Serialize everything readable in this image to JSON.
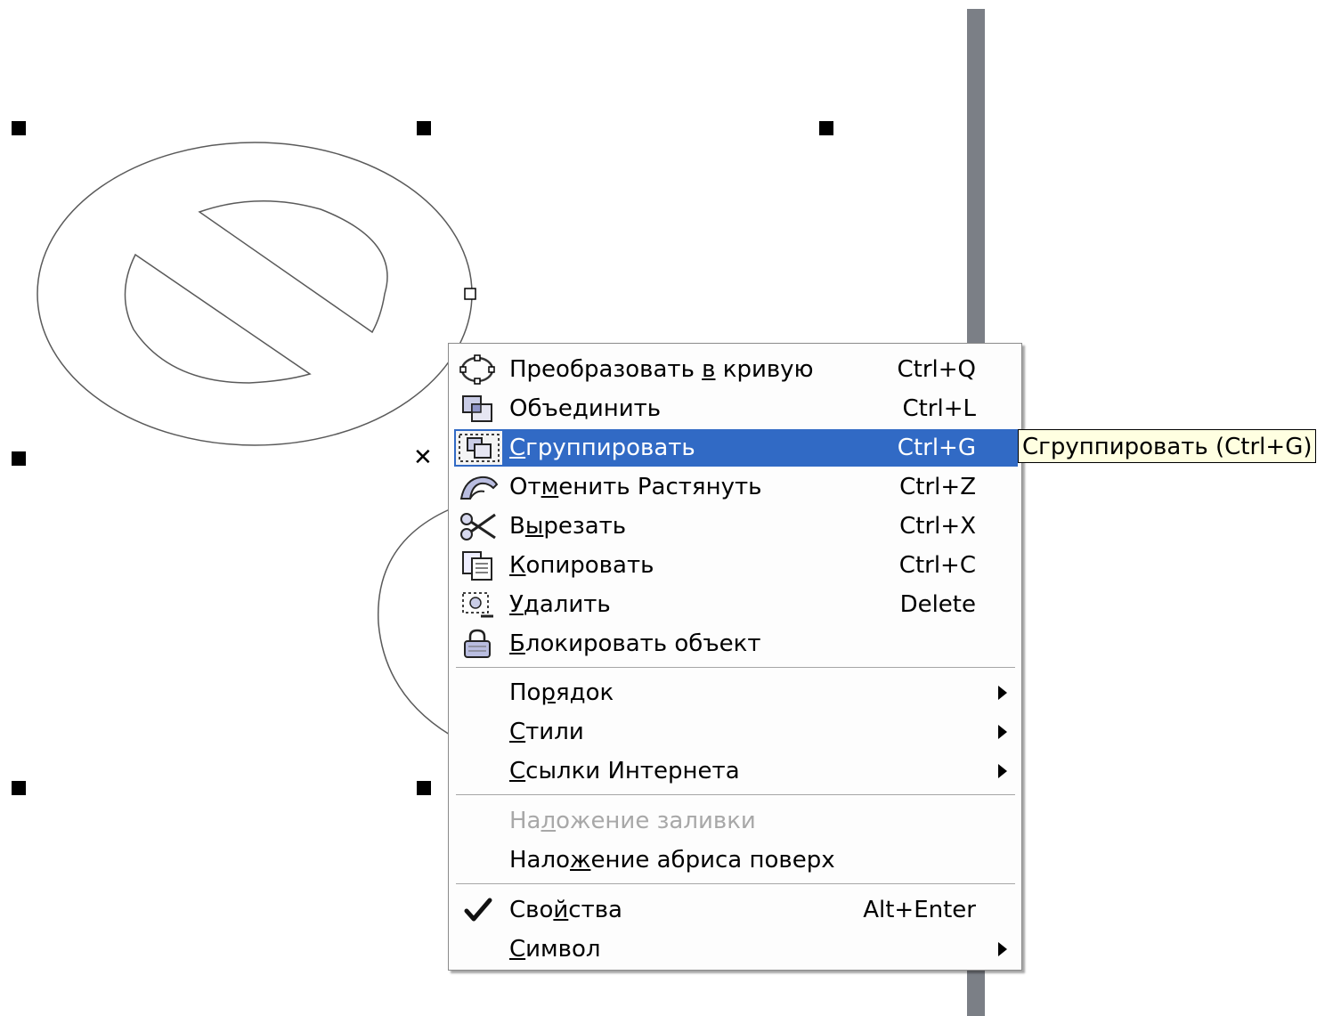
{
  "menu": {
    "items": [
      {
        "pre": "Преобразовать ",
        "ak": "в",
        "post": " кривую",
        "shortcut": "Ctrl+Q",
        "icon": "convert-to-curves-icon"
      },
      {
        "pre": "Объе",
        "ak": "д",
        "post": "инить",
        "shortcut": "Ctrl+L",
        "icon": "combine-icon"
      },
      {
        "pre": "",
        "ak": "С",
        "post": "группировать",
        "shortcut": "Ctrl+G",
        "icon": "group-icon",
        "highlighted": true
      },
      {
        "pre": "От",
        "ak": "м",
        "post": "енить Растянуть",
        "shortcut": "Ctrl+Z",
        "icon": "undo-stretch-icon"
      },
      {
        "pre": "В",
        "ak": "ы",
        "post": "резать",
        "shortcut": "Ctrl+X",
        "icon": "scissors-icon"
      },
      {
        "pre": "",
        "ak": "К",
        "post": "опировать",
        "shortcut": "Ctrl+C",
        "icon": "copy-icon"
      },
      {
        "pre": "",
        "ak": "У",
        "post": "далить",
        "shortcut": "Delete",
        "icon": "delete-icon"
      },
      {
        "pre": "",
        "ak": "Б",
        "post": "локировать объект",
        "shortcut": "",
        "icon": "lock-icon"
      },
      {
        "pre": "По",
        "ak": "р",
        "post": "ядок",
        "shortcut": "",
        "submenu": true
      },
      {
        "pre": "",
        "ak": "С",
        "post": "тили",
        "shortcut": "",
        "submenu": true
      },
      {
        "pre": "",
        "ak": "С",
        "post": "сылки Интернета",
        "shortcut": "",
        "submenu": true
      },
      {
        "pre": "На",
        "ak": "л",
        "post": "ожение заливки",
        "shortcut": "",
        "disabled": true
      },
      {
        "pre": "Нало",
        "ak": "ж",
        "post": "ение абриса поверх",
        "shortcut": ""
      },
      {
        "pre": "Сво",
        "ak": "й",
        "post": "ства",
        "shortcut": "Alt+Enter",
        "icon": "checkmark-icon"
      },
      {
        "pre": "",
        "ak": "С",
        "post": "имвол",
        "shortcut": "",
        "submenu": true
      }
    ]
  },
  "tooltip": {
    "text": "Сгруппировать (Ctrl+G)"
  },
  "colors": {
    "highlight": "#316ac5",
    "tooltip_bg": "#ffffe1",
    "disabled_text": "#a8a8a8"
  }
}
